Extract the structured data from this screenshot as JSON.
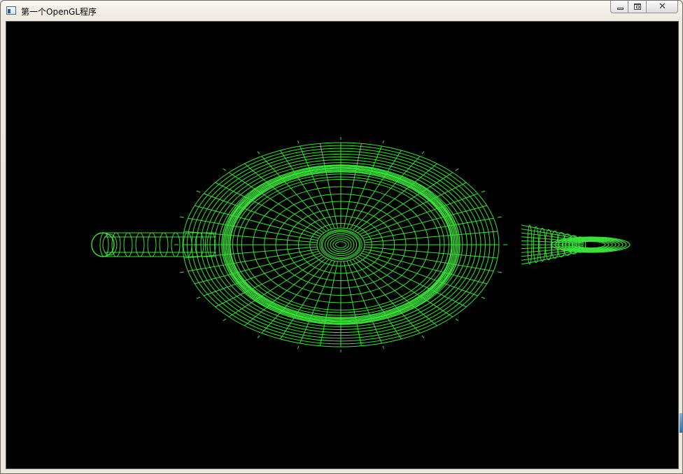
{
  "window": {
    "title": "第一个OpenGL程序",
    "controls": {
      "minimize": "minimize-icon",
      "maximize": "restore-icon",
      "close": "close-icon"
    }
  },
  "viewport": {
    "background_color": "#000000",
    "wireframe_color": "#38e238",
    "object": "teapot-wireframe-top-view"
  }
}
